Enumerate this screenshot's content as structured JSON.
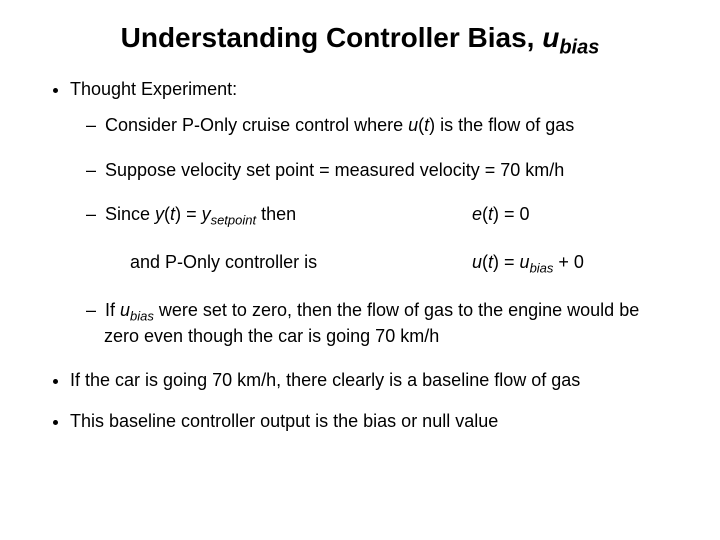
{
  "title": {
    "main": "Understanding Controller Bias, ",
    "var": "u",
    "sub": "bias"
  },
  "bullet1": "Thought Experiment:",
  "sub1_a": "Consider P-Only cruise control where ",
  "sub1_u": "u",
  "sub1_paren_open": "(",
  "sub1_t": "t",
  "sub1_paren_close": ")",
  "sub1_b": " is the flow of gas",
  "sub2": "Suppose velocity set point = measured velocity =  70 km/h",
  "sub3_left_a": "Since ",
  "sub3_y": "y",
  "sub3_paren_open": "(",
  "sub3_t": "t",
  "sub3_paren_close": ")",
  "sub3_eq": " = ",
  "sub3_y2": "y",
  "sub3_setpoint": "setpoint",
  "sub3_then": " then",
  "sub3_right_e": "e",
  "sub3_right_po": "(",
  "sub3_right_t": "t",
  "sub3_right_pc": ")",
  "sub3_right_eq0": " = 0",
  "sub3b_left": "and P-Only controller is",
  "sub3b_u": "u",
  "sub3b_po": "(",
  "sub3b_t": "t",
  "sub3b_pc": ")",
  "sub3b_eq": " = ",
  "sub3b_u2": "u",
  "sub3b_bias": "bias",
  "sub3b_plus0": " + 0",
  "sub4_a": "If ",
  "sub4_u": "u",
  "sub4_bias": "bias",
  "sub4_b": " were set to zero, then the flow of gas to the engine would be zero even though the car is going 70 km/h",
  "bullet2": "If the car is going 70 km/h, there clearly is a baseline flow of gas",
  "bullet3": "This baseline controller output is the bias or null value"
}
